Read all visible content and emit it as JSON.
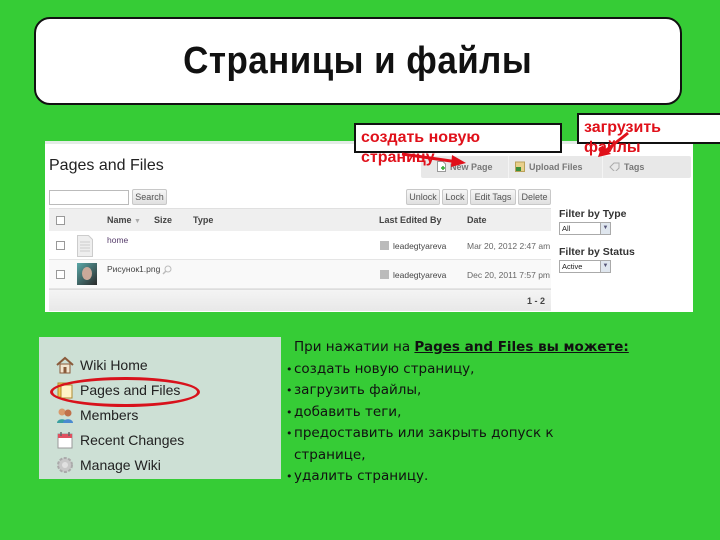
{
  "slide": {
    "title": "Страницы и файлы",
    "background_color": "#36cc36"
  },
  "pages_files": {
    "title": "Pages and Files",
    "actions": [
      {
        "label": "New Page",
        "icon": "new-page-icon"
      },
      {
        "label": "Upload Files",
        "icon": "upload-icon"
      },
      {
        "label": "Tags",
        "icon": "tag-icon"
      }
    ],
    "search": {
      "value": "",
      "button_label": "Search"
    },
    "bulk_buttons": [
      "Unlock",
      "Lock",
      "Edit Tags",
      "Delete"
    ],
    "columns": {
      "name": "Name",
      "size": "Size",
      "type": "Type",
      "last_edited_by": "Last Edited By",
      "date": "Date"
    },
    "rows": [
      {
        "name": "home",
        "size": "",
        "type": "",
        "editor": "leadegtyareva",
        "date": "Mar 20, 2012 2:47 am",
        "thumb": "document-icon"
      },
      {
        "name": "Рисунок1.png",
        "size": "",
        "type": "",
        "editor": "leadegtyareva",
        "date": "Dec 20, 2011 7:57 pm",
        "thumb": "image-thumbnail"
      }
    ],
    "pager": "1 - 2",
    "filters": {
      "type_label": "Filter by Type",
      "type_value": "All",
      "status_label": "Filter by Status",
      "status_value": "Active"
    }
  },
  "callouts": {
    "new_page_line1": "создать новую",
    "new_page_line2": "страницу",
    "upload_line1": "загрузить",
    "upload_line2": "файлы",
    "color": "#e0101a"
  },
  "sidebar": {
    "items": [
      {
        "label": "Wiki Home",
        "icon": "home-icon"
      },
      {
        "label": "Pages and Files",
        "icon": "pages-files-icon",
        "highlighted": true
      },
      {
        "label": "Members",
        "icon": "members-icon"
      },
      {
        "label": "Recent Changes",
        "icon": "calendar-icon"
      },
      {
        "label": "Manage Wiki",
        "icon": "gear-icon"
      }
    ]
  },
  "description": {
    "intro_prefix": "При нажатии на ",
    "intro_bold": "Pages and Files вы можете:",
    "bullets": [
      "создать новую страницу,",
      "загрузить файлы,",
      "добавить теги,",
      "предоставить или закрыть допуск к",
      "удалить страницу."
    ],
    "bullet_4_continuation": "странице,"
  }
}
